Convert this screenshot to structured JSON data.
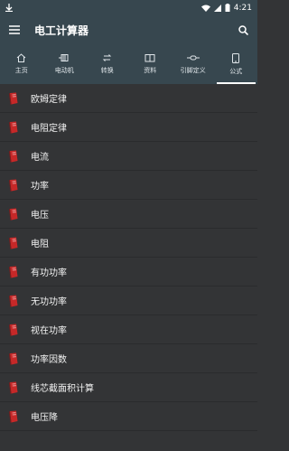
{
  "status": {
    "time": "4:21"
  },
  "appbar": {
    "title": "电工计算器"
  },
  "tabs": [
    {
      "label": "主页",
      "icon": "home-icon"
    },
    {
      "label": "电动机",
      "icon": "motor-icon"
    },
    {
      "label": "转换",
      "icon": "convert-icon"
    },
    {
      "label": "资料",
      "icon": "book-icon"
    },
    {
      "label": "引脚定义",
      "icon": "pin-icon"
    },
    {
      "label": "公式",
      "icon": "phone-icon"
    }
  ],
  "active_tab": "公式",
  "list": [
    "欧姆定律",
    "电阻定律",
    "电流",
    "功率",
    "电压",
    "电阻",
    "有功功率",
    "无功功率",
    "视在功率",
    "功率因数",
    "线芯截面积计算",
    "电压降"
  ],
  "colors": {
    "bar": "#37474f",
    "list_bg": "#333436",
    "icon": "#c62828"
  }
}
